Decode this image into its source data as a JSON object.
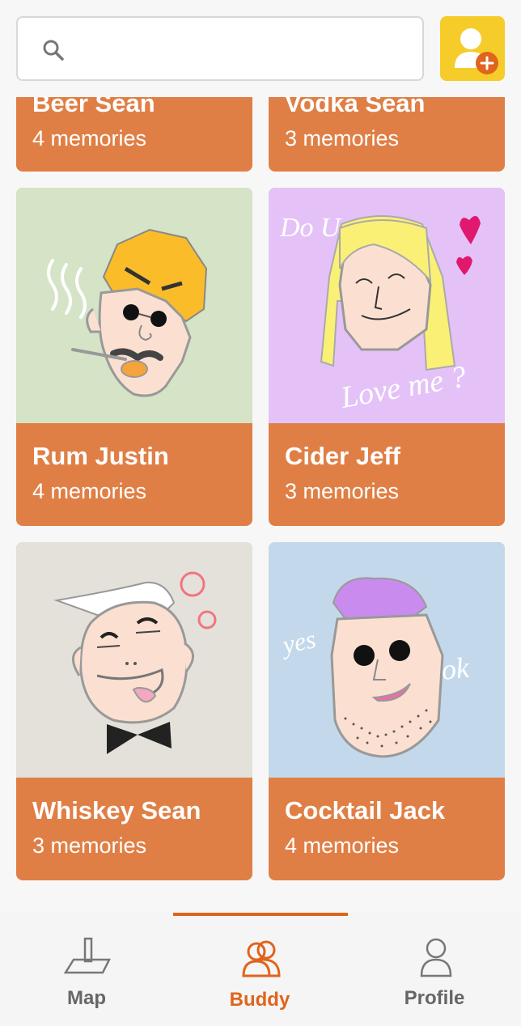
{
  "search": {
    "placeholder": "",
    "value": ""
  },
  "buddies": [
    {
      "name": "Beer Sean",
      "memories": "4 memories"
    },
    {
      "name": "Vodka Sean",
      "memories": "3 memories"
    },
    {
      "name": "Rum Justin",
      "memories": "4 memories"
    },
    {
      "name": "Cider Jeff",
      "memories": "3 memories"
    },
    {
      "name": "Whiskey Sean",
      "memories": "3 memories"
    },
    {
      "name": "Cocktail Jack",
      "memories": "4 memories"
    }
  ],
  "illustrations": {
    "cider_jeff": {
      "text1": "Do U",
      "text2": "Love me ?"
    },
    "cocktail_jack": {
      "text1": "yes",
      "text2": "ok"
    }
  },
  "nav": {
    "tabs": [
      {
        "label": "Map",
        "icon": "map-icon"
      },
      {
        "label": "Buddy",
        "icon": "buddy-icon"
      },
      {
        "label": "Profile",
        "icon": "profile-icon"
      }
    ],
    "active": "Buddy"
  },
  "colors": {
    "accent": "#e0641b",
    "card": "#e07f45",
    "add_button": "#f6cc2a"
  }
}
